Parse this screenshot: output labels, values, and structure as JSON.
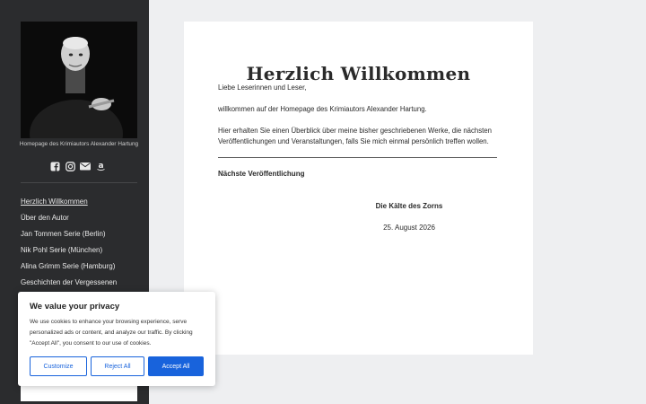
{
  "sidebar": {
    "photo_alt": "Alexander Hartung",
    "caption": "Homepage des Krimiautors Alexander Hartung",
    "social_icons": [
      "facebook-icon",
      "instagram-icon",
      "mail-icon",
      "amazon-icon"
    ],
    "nav": [
      {
        "label": "Herzlich Willkommen",
        "active": true
      },
      {
        "label": "Über den Autor"
      },
      {
        "label": "Jan Tommen Serie (Berlin)"
      },
      {
        "label": "Nik Pohl Serie (München)"
      },
      {
        "label": "Alina Grimm Serie (Hamburg)"
      },
      {
        "label": "Geschichten der Vergessenen"
      }
    ]
  },
  "main": {
    "title": "Herzlich Willkommen",
    "paragraphs": [
      "Liebe Leserinnen und Leser,",
      "willkommen auf der Homepage des Krimiautors Alexander Hartung.",
      "Hier erhalten Sie einen Überblick über meine bisher geschriebenen Werke, die nächsten Veröffentlichungen und Veranstaltungen, falls Sie mich einmal persönlich treffen wollen."
    ],
    "section_heading": "Nächste Veröffentlichung",
    "book_title": "Die Kälte des Zorns",
    "book_date": "25. August 2026"
  },
  "cookie": {
    "title": "We value your privacy",
    "text": "We use cookies to enhance your browsing experience, serve personalized ads or content, and analyze our traffic. By clicking \"Accept All\", you consent to our use of cookies.",
    "customize": "Customize",
    "reject": "Reject All",
    "accept": "Accept All"
  },
  "colors": {
    "sidebar_bg": "#2b2c2e",
    "page_bg": "#eeeff1",
    "accent": "#1863dc"
  }
}
